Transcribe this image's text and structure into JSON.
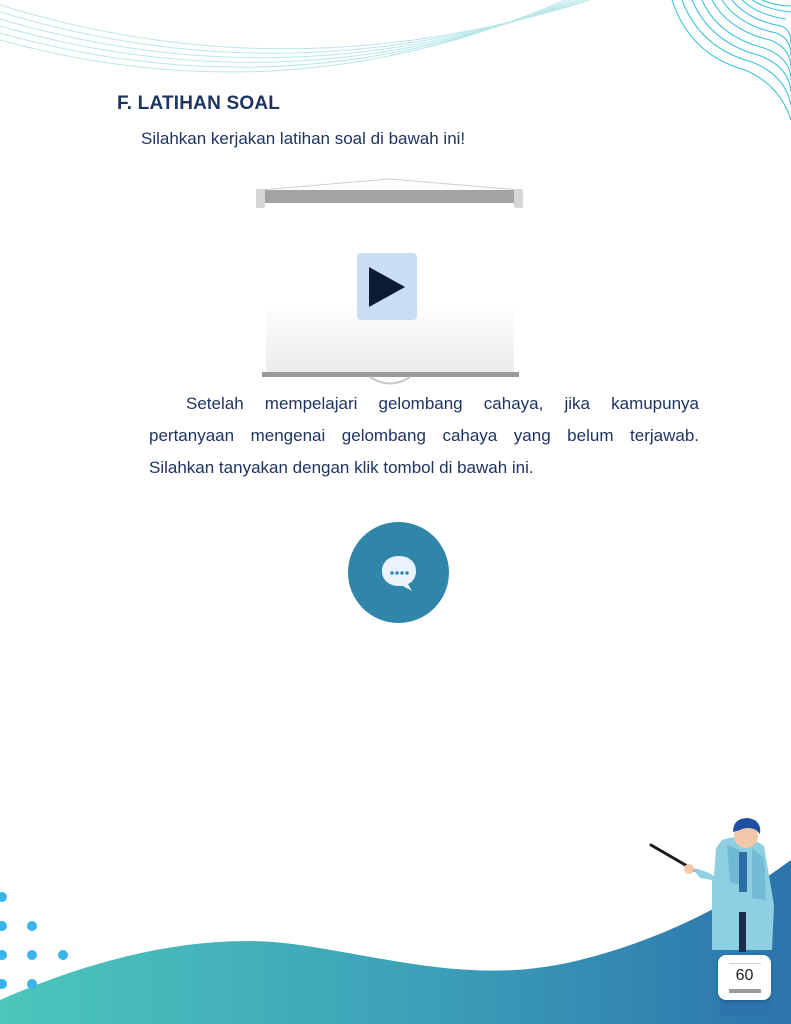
{
  "section": {
    "heading": "F. LATIHAN SOAL",
    "intro": "Silahkan kerjakan latihan soal di bawah ini!"
  },
  "video": {
    "icon": "play-icon",
    "button_color": "#c9def5"
  },
  "question_text": {
    "line1": "Setelah mempelajari gelombang cahaya, jika kamupunya",
    "line2": "pertanyaan mengenai gelombang cahaya yang belum terjawab.",
    "line3": "Silahkan tanyakan  dengan klik tombol di bawah ini."
  },
  "chat": {
    "icon": "chat-bubble-icon",
    "button_color": "#2f86a8"
  },
  "footer": {
    "page_number": "60"
  },
  "colors": {
    "text": "#1e3461",
    "wave_teal": "#3fbfb6",
    "wave_blue": "#2f7fb0",
    "dots": "#3ab2ea"
  }
}
